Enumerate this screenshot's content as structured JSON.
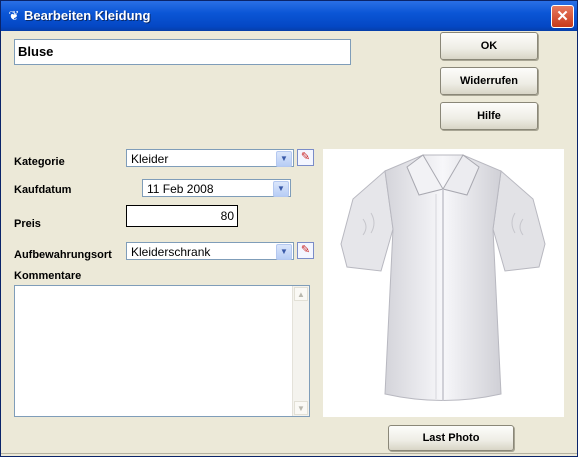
{
  "window": {
    "title": "Bearbeiten Kleidung",
    "close_glyph": "✕"
  },
  "name_value": "Bluse",
  "buttons": {
    "ok": "OK",
    "undo": "Widerrufen",
    "help": "Hilfe",
    "last_photo": "Last Photo"
  },
  "fields": {
    "kategorie": {
      "label": "Kategorie",
      "value": "Kleider"
    },
    "kaufdatum": {
      "label": "Kaufdatum",
      "value": "11 Feb 2008"
    },
    "preis": {
      "label": "Preis",
      "value": "80"
    },
    "aufbewahrungsort": {
      "label": "Aufbewahrungsort",
      "value": "Kleiderschrank"
    },
    "kommentare": {
      "label": "Kommentare",
      "value": ""
    }
  },
  "icons": {
    "app": "clothing-app-icon",
    "dropdown": "chevron-down-icon",
    "edit": "pencil-edit-icon",
    "scroll_up": "scroll-up-icon",
    "scroll_down": "scroll-down-icon"
  },
  "colors": {
    "titlebar": "#0b56d6",
    "dialog_bg": "#ece9d8",
    "close_button": "#c7391a",
    "field_border": "#7f9db9"
  }
}
